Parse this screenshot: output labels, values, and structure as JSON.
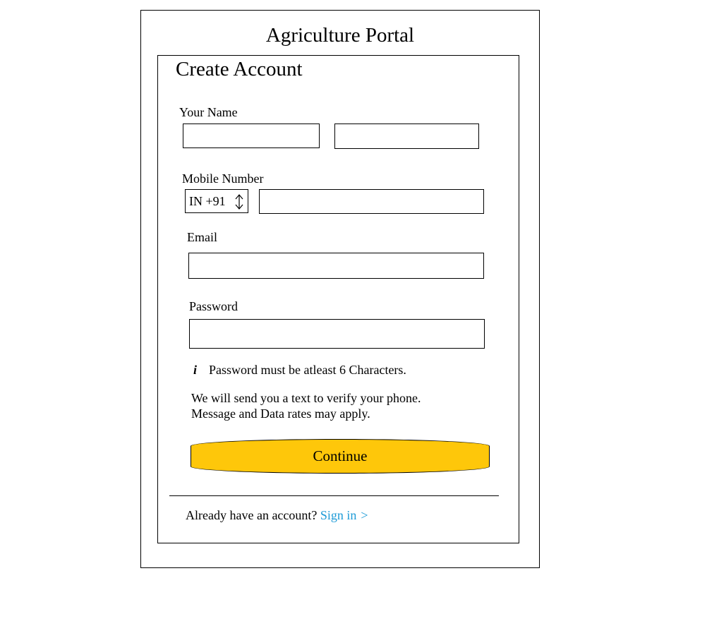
{
  "app": {
    "title": "Agriculture Portal"
  },
  "form": {
    "heading": "Create Account",
    "name": {
      "label": "Your Name",
      "first_value": "",
      "last_value": ""
    },
    "mobile": {
      "label": "Mobile Number",
      "country_code": "IN +91",
      "value": ""
    },
    "email": {
      "label": "Email",
      "value": ""
    },
    "password": {
      "label": "Password",
      "value": "",
      "hint_icon": "i",
      "hint": "Password must be atleast 6 Characters."
    },
    "notice": {
      "line1": "We will send you a text to verify your phone.",
      "line2": "Message and Data rates may apply."
    },
    "continue_label": "Continue",
    "signin": {
      "prompt": "Already have an account?",
      "link_label": "Sign in",
      "chevron": ">"
    }
  },
  "colors": {
    "button_fill": "#fec70a",
    "link": "#1e9bd7"
  },
  "icons": {
    "country_select": "up-down-arrow-icon",
    "password_hint": "info-icon",
    "signin": "chevron-right-icon"
  }
}
